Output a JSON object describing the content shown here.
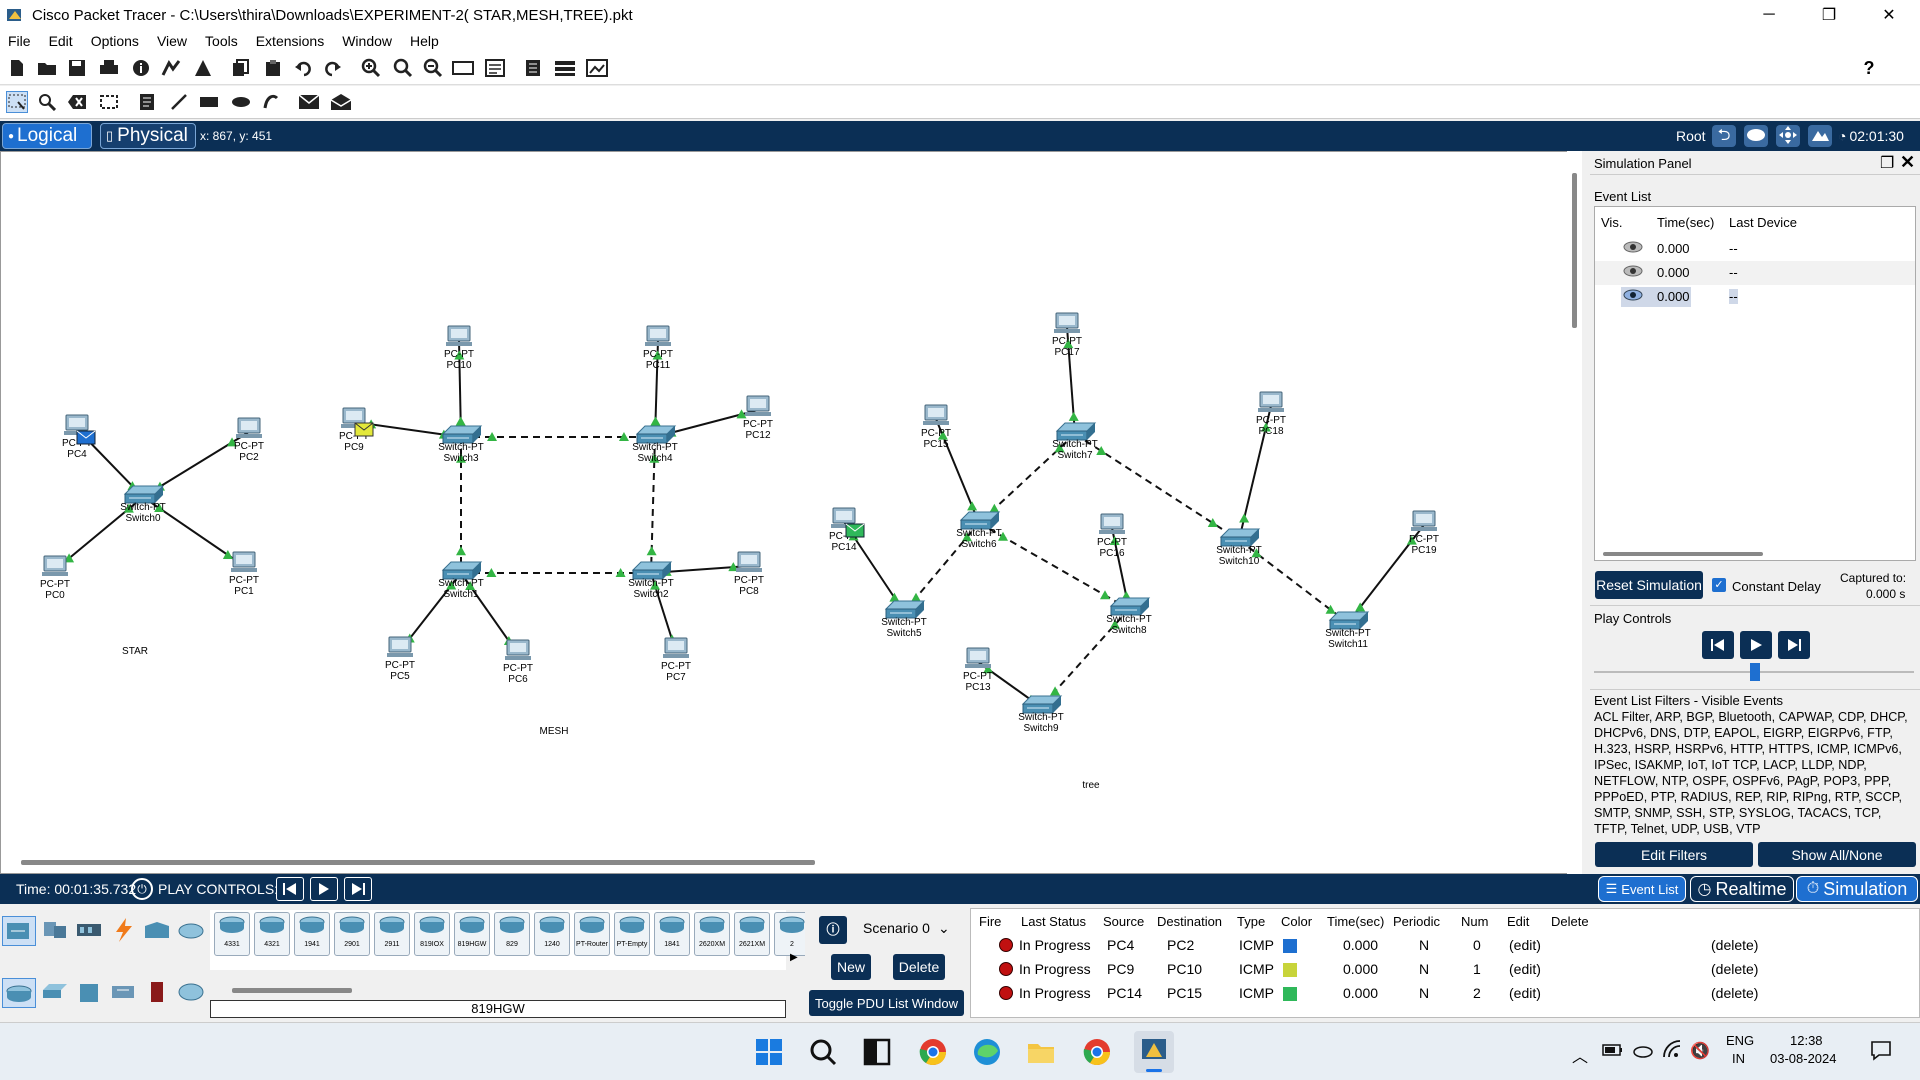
{
  "window": {
    "title": "Cisco Packet Tracer - C:\\Users\\thira\\Downloads\\EXPERIMENT-2( STAR,MESH,TREE).pkt",
    "minimize": "─",
    "maximize": "❐",
    "close": "✕"
  },
  "menu": [
    "File",
    "Edit",
    "Options",
    "View",
    "Tools",
    "Extensions",
    "Window",
    "Help"
  ],
  "help_icon": "?",
  "modebar": {
    "logical": "Logical",
    "physical": "Physical",
    "coords": "x: 867, y: 451",
    "root": "Root",
    "clock": "02:01:30"
  },
  "topology_labels": {
    "star": "STAR",
    "mesh": "MESH",
    "tree": "tree"
  },
  "devices": {
    "PC0": [
      "PC-PT",
      "PC0"
    ],
    "PC1": [
      "PC-PT",
      "PC1"
    ],
    "PC2": [
      "PC-PT",
      "PC2"
    ],
    "PC4": [
      "PC-PT",
      "PC4"
    ],
    "PC5": [
      "PC-PT",
      "PC5"
    ],
    "PC6": [
      "PC-PT",
      "PC6"
    ],
    "PC7": [
      "PC-PT",
      "PC7"
    ],
    "PC8": [
      "PC-PT",
      "PC8"
    ],
    "PC9": [
      "PC-PT",
      "PC9"
    ],
    "PC10": [
      "PC-PT",
      "PC10"
    ],
    "PC11": [
      "PC-PT",
      "PC11"
    ],
    "PC12": [
      "PC-PT",
      "PC12"
    ],
    "PC13": [
      "PC-PT",
      "PC13"
    ],
    "PC14": [
      "PC-PT",
      "PC14"
    ],
    "PC15": [
      "PC-PT",
      "PC15"
    ],
    "PC16": [
      "PC-PT",
      "PC16"
    ],
    "PC17": [
      "PC-PT",
      "PC17"
    ],
    "PC18": [
      "PC-PT",
      "PC18"
    ],
    "PC19": [
      "PC-PT",
      "PC19"
    ],
    "Switch0": [
      "Switch-PT",
      "Switch0"
    ],
    "Switch1": [
      "Switch-PT",
      "Switch1"
    ],
    "Switch2": [
      "Switch-PT",
      "Switch2"
    ],
    "Switch3": [
      "Switch-PT",
      "Switch3"
    ],
    "Switch4": [
      "Switch-PT",
      "Switch4"
    ],
    "Switch5": [
      "Switch-PT",
      "Switch5"
    ],
    "Switch6": [
      "Switch-PT",
      "Switch6"
    ],
    "Switch7": [
      "Switch-PT",
      "Switch7"
    ],
    "Switch8": [
      "Switch-PT",
      "Switch8"
    ],
    "Switch9": [
      "Switch-PT",
      "Switch9"
    ],
    "Switch10": [
      "Switch-PT",
      "Switch10"
    ],
    "Switch11": [
      "Switch-PT",
      "Switch11"
    ]
  },
  "sim_panel": {
    "title": "Simulation Panel",
    "event_list_label": "Event List",
    "columns": [
      "Vis.",
      "Time(sec)",
      "Last Device"
    ],
    "events": [
      {
        "time": "0.000",
        "device": "--"
      },
      {
        "time": "0.000",
        "device": "--"
      },
      {
        "time": "0.000",
        "device": "--"
      }
    ],
    "reset_button": "Reset Simulation",
    "constant_delay": "Constant Delay",
    "captured_label": "Captured to:",
    "captured_value": "0.000 s",
    "play_controls": "Play Controls",
    "filters_title": "Event List Filters - Visible Events",
    "filters_text": "ACL Filter, ARP, BGP, Bluetooth, CAPWAP, CDP, DHCP, DHCPv6, DNS, DTP, EAPOL, EIGRP, EIGRPv6, FTP, H.323, HSRP, HSRPv6, HTTP, HTTPS, ICMP, ICMPv6, IPSec, ISAKMP, IoT, IoT TCP, LACP, LLDP, NDP, NETFLOW, NTP, OSPF, OSPFv6, PAgP, POP3, PPP, PPPoED, PTP, RADIUS, REP, RIP, RIPng, RTP, SCCP, SMTP, SNMP, SSH, STP, SYSLOG, TACACS, TCP, TFTP, Telnet, UDP, USB, VTP",
    "edit_filters": "Edit Filters",
    "show_all": "Show All/None"
  },
  "bottombar": {
    "time": "Time: 00:01:35.732",
    "play_controls": "PLAY CONTROLS:",
    "event_list": "Event List",
    "realtime": "Realtime",
    "simulation": "Simulation"
  },
  "device_models": [
    "4331",
    "4321",
    "1941",
    "2901",
    "2911",
    "819IOX",
    "819HGW",
    "829",
    "1240",
    "PT-Router",
    "PT-Empty",
    "1841",
    "2620XM",
    "2621XM",
    "2"
  ],
  "selected_model": "819HGW",
  "pdu_panel": {
    "scenario": "Scenario 0",
    "new": "New",
    "delete": "Delete",
    "toggle": "Toggle PDU List Window"
  },
  "pdu_table": {
    "columns": [
      "Fire",
      "Last Status",
      "Source",
      "Destination",
      "Type",
      "Color",
      "Time(sec)",
      "Periodic",
      "Num",
      "Edit",
      "Delete"
    ],
    "rows": [
      {
        "status": "In Progress",
        "source": "PC4",
        "dest": "PC2",
        "type": "ICMP",
        "color": "#1e6fd0",
        "time": "0.000",
        "periodic": "N",
        "num": "0",
        "edit": "(edit)",
        "delete": "(delete)"
      },
      {
        "status": "In Progress",
        "source": "PC9",
        "dest": "PC10",
        "type": "ICMP",
        "color": "#c8d43a",
        "time": "0.000",
        "periodic": "N",
        "num": "1",
        "edit": "(edit)",
        "delete": "(delete)"
      },
      {
        "status": "In Progress",
        "source": "PC14",
        "dest": "PC15",
        "type": "ICMP",
        "color": "#2fb85a",
        "time": "0.000",
        "periodic": "N",
        "num": "2",
        "edit": "(edit)",
        "delete": "(delete)"
      }
    ]
  },
  "tray": {
    "lang1": "ENG",
    "lang2": "IN",
    "time": "12:38",
    "date": "03-08-2024"
  },
  "colors": {
    "navy": "#0b2f55",
    "link_green": "#2fb84a",
    "switch": "#4a8fb3"
  }
}
